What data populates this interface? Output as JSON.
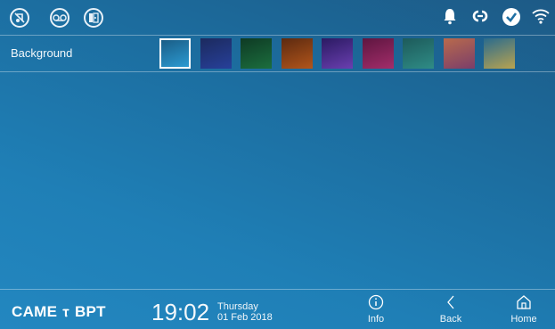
{
  "topbar": {
    "left_icons": [
      "mute-ringtone-icon",
      "voicemail-icon",
      "door-status-icon"
    ],
    "right_icons": [
      "bell-icon",
      "link-icon",
      "check-icon",
      "wifi-icon"
    ]
  },
  "settings": {
    "background_label": "Background",
    "swatch_count": 9,
    "selected_index": 0,
    "swatches": [
      [
        "#1a5d86",
        "#2c9ad2"
      ],
      [
        "#1c2a5e",
        "#27409a"
      ],
      [
        "#0e3a24",
        "#1c6e3e"
      ],
      [
        "#5c2a10",
        "#b2551b"
      ],
      [
        "#2b1a62",
        "#6a3fb0"
      ],
      [
        "#5e1640",
        "#a32d6a"
      ],
      [
        "#1d5a5a",
        "#2f8c86"
      ],
      [
        "#b86a4c",
        "#7b3e6a"
      ],
      [
        "#2a6b8d",
        "#b9a350"
      ]
    ]
  },
  "brand": {
    "left": "CAME",
    "symbol": "ⲧ",
    "right": "BPT"
  },
  "clock": {
    "time": "19:02",
    "day": "Thursday",
    "date": "01 Feb 2018"
  },
  "nav": {
    "info": "Info",
    "back": "Back",
    "home": "Home"
  }
}
